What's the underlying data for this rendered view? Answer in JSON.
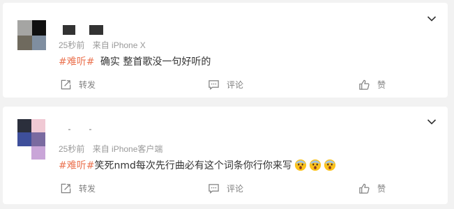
{
  "posts": [
    {
      "time": "25秒前",
      "source": "来自 iPhone X",
      "tag": "#难听#",
      "text": "确实 整首歌没一句好听的",
      "avatar_colors": [
        "#a5a5a3",
        "#101010",
        "#6f6a5e",
        "#7f8ea0"
      ],
      "repost_label": "转发",
      "comment_label": "评论",
      "like_label": "赞",
      "has_emoji": false
    },
    {
      "time": "25秒前",
      "source": "来自 iPhone客户端",
      "tag": "#难听#",
      "text": "笑死nmd每次先行曲必有这个词条你行你来写",
      "avatar_colors": [
        "#2b2f3c",
        "#f0c9d4",
        "#3e4f9b",
        "#7a6aa0",
        "#ffffff",
        "#c9a5d8"
      ],
      "repost_label": "转发",
      "comment_label": "评论",
      "like_label": "赞",
      "has_emoji": true,
      "emoji_count": 3
    }
  ],
  "colors": {
    "accent": "#eb7350",
    "meta": "#999999",
    "action": "#808080",
    "background": "#f2f2f2"
  },
  "icons": {
    "repost": "share-box-icon",
    "comment": "chat-bubble-icon",
    "like": "thumbs-up-icon",
    "menu": "chevron-down-icon",
    "emoji": "scared-face-emoji"
  }
}
